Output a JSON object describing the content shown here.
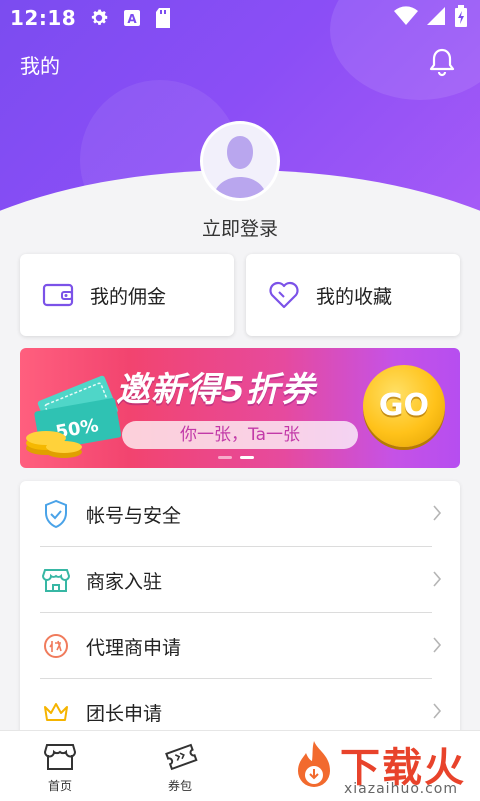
{
  "status_bar": {
    "time": "12:18",
    "icons": [
      "gear-icon",
      "a-icon",
      "sd-card-icon",
      "wifi-icon",
      "signal-icon",
      "battery-icon"
    ]
  },
  "header": {
    "title": "我的",
    "notification_icon": "bell-icon"
  },
  "profile": {
    "avatar_icon": "user-avatar-icon",
    "login_label": "立即登录"
  },
  "quick_cards": [
    {
      "label": "我的佣金",
      "icon": "wallet-icon"
    },
    {
      "label": "我的收藏",
      "icon": "heart-icon"
    }
  ],
  "banner": {
    "coupon_text": "50%",
    "headline": "邀新得5折券",
    "subtitle": "你一张，Ta一张",
    "cta": "GO",
    "page_count": 2,
    "active_index": 1
  },
  "menu": [
    {
      "label": "帐号与安全",
      "icon": "shield-check-icon"
    },
    {
      "label": "商家入驻",
      "icon": "store-icon"
    },
    {
      "label": "代理商申请",
      "icon": "agent-badge-icon"
    },
    {
      "label": "团长申请",
      "icon": "crown-icon"
    }
  ],
  "tabbar": [
    {
      "label": "首页",
      "icon": "shop-home-icon"
    },
    {
      "label": "券包",
      "icon": "ticket-icon"
    }
  ],
  "watermark": {
    "text": "下载火",
    "sub": "xiazaihuo.com"
  },
  "colors": {
    "header_purple": "#8b4ef6",
    "accent_purple": "#7b52e8",
    "banner_pink": "#f2446f",
    "go_yellow": "#ffc21a",
    "watermark_red": "#e8432b"
  }
}
